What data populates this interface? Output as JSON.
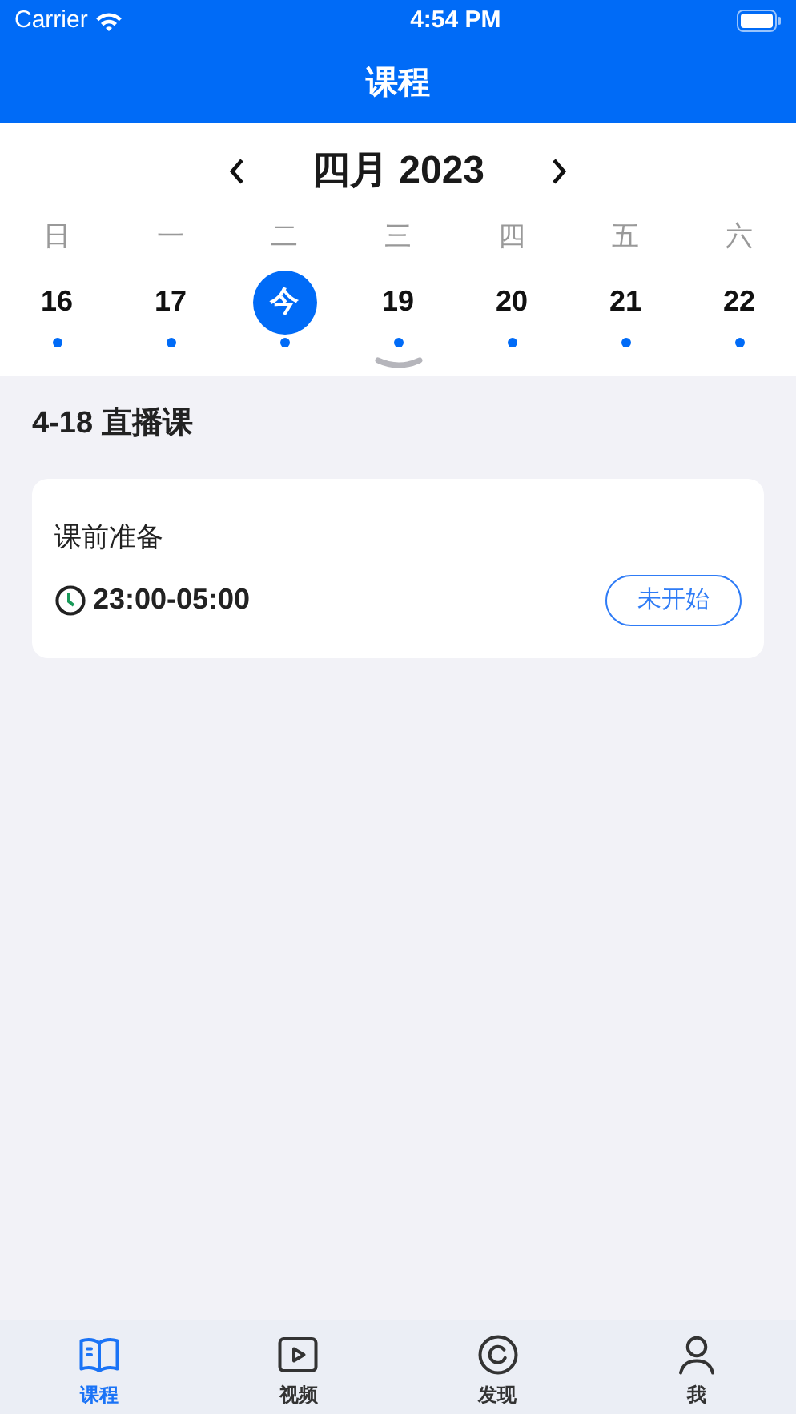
{
  "status_bar": {
    "carrier": "Carrier",
    "time": "4:54 PM"
  },
  "title": "课程",
  "calendar": {
    "month": "四月 2023",
    "weekdays": [
      "日",
      "一",
      "二",
      "三",
      "四",
      "五",
      "六"
    ],
    "days": [
      {
        "label": "16",
        "selected": false,
        "has_event": true
      },
      {
        "label": "17",
        "selected": false,
        "has_event": true
      },
      {
        "label": "今",
        "selected": true,
        "has_event": true
      },
      {
        "label": "19",
        "selected": false,
        "has_event": true
      },
      {
        "label": "20",
        "selected": false,
        "has_event": true
      },
      {
        "label": "21",
        "selected": false,
        "has_event": true
      },
      {
        "label": "22",
        "selected": false,
        "has_event": true
      }
    ]
  },
  "section_title": "4-18 直播课",
  "lessons": [
    {
      "title": "课前准备",
      "time": "23:00-05:00",
      "status": "未开始"
    }
  ],
  "tab_bar": [
    {
      "kind": "book",
      "label": "课程",
      "selected": true
    },
    {
      "kind": "video",
      "label": "视频",
      "selected": false
    },
    {
      "kind": "discover",
      "label": "发现",
      "selected": false
    },
    {
      "kind": "person",
      "label": "我",
      "selected": false
    }
  ]
}
